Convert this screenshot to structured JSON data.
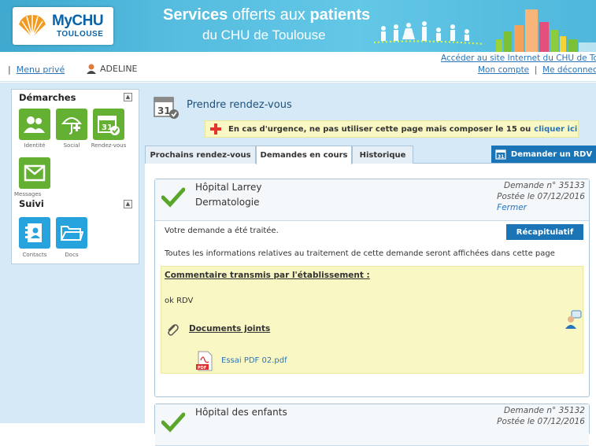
{
  "header": {
    "logo_brand": "MyCHU",
    "logo_sub": "TOULOUSE",
    "title_part1": "Services ",
    "title_part2": "offerts aux ",
    "title_part3": "patients",
    "subtitle": "du CHU de Toulouse"
  },
  "topnav": {
    "separator": "|",
    "menu_label": "Menu privé",
    "user_name": "ADELINE",
    "site_link": "Accéder au site Internet du CHU de Toul",
    "account_label": "Mon compte",
    "logout_label": "Me déconnecte"
  },
  "sidebar": {
    "section1_title": "Démarches",
    "section1_items": [
      {
        "label": "Identité",
        "icon": "identity-icon"
      },
      {
        "label": "Social",
        "icon": "umbrella-icon"
      },
      {
        "label": "Rendez-vous",
        "icon": "calendar-check-icon"
      },
      {
        "label": "Messages",
        "icon": "envelope-icon"
      }
    ],
    "section2_title": "Suivi",
    "section2_items": [
      {
        "label": "Contacts",
        "icon": "contacts-icon"
      },
      {
        "label": "Docs",
        "icon": "folder-icon"
      }
    ],
    "toggle_symbol": "▲"
  },
  "main": {
    "title": "Prendre rendez-vous",
    "calendar_day": "31",
    "warning_text": "En cas d'urgence, ne pas utiliser cette page mais composer le 15 ou",
    "warning_link": "cliquer ici",
    "tabs": [
      {
        "label": "Prochains rendez-vous",
        "active": false
      },
      {
        "label": "Demandes en cours",
        "active": true
      },
      {
        "label": "Historique",
        "active": false
      }
    ],
    "request_button": "Demander un RDV"
  },
  "requests": [
    {
      "hospital": "Hôpital Larrey",
      "specialty": "Dermatologie",
      "number": "Demande n° 35133",
      "posted": "Postée le 07/12/2016",
      "close_label": "Fermer",
      "status_text": "Votre demande a été traitée.",
      "recap_button": "Récapitulatif",
      "info_text": "Toutes les informations relatives au traitement de cette demande seront affichées dans cette page",
      "comment_title": "Commentaire transmis par l'établissement :",
      "comment_body": "ok RDV",
      "documents_title": "Documents joints",
      "document_name": "Essai PDF 02.pdf",
      "pdf_badge": "PDF"
    },
    {
      "hospital": "Hôpital des enfants",
      "number": "Demande n° 35132",
      "posted": "Postée le 07/12/2016"
    }
  ],
  "colors": {
    "header_blue": "#4fb7dc",
    "tile_green": "#63b033",
    "tile_blue": "#26a2dc",
    "button_blue": "#1a74b6",
    "page_bg": "#d6e9f7",
    "notice_yellow": "#f9f8c4"
  }
}
